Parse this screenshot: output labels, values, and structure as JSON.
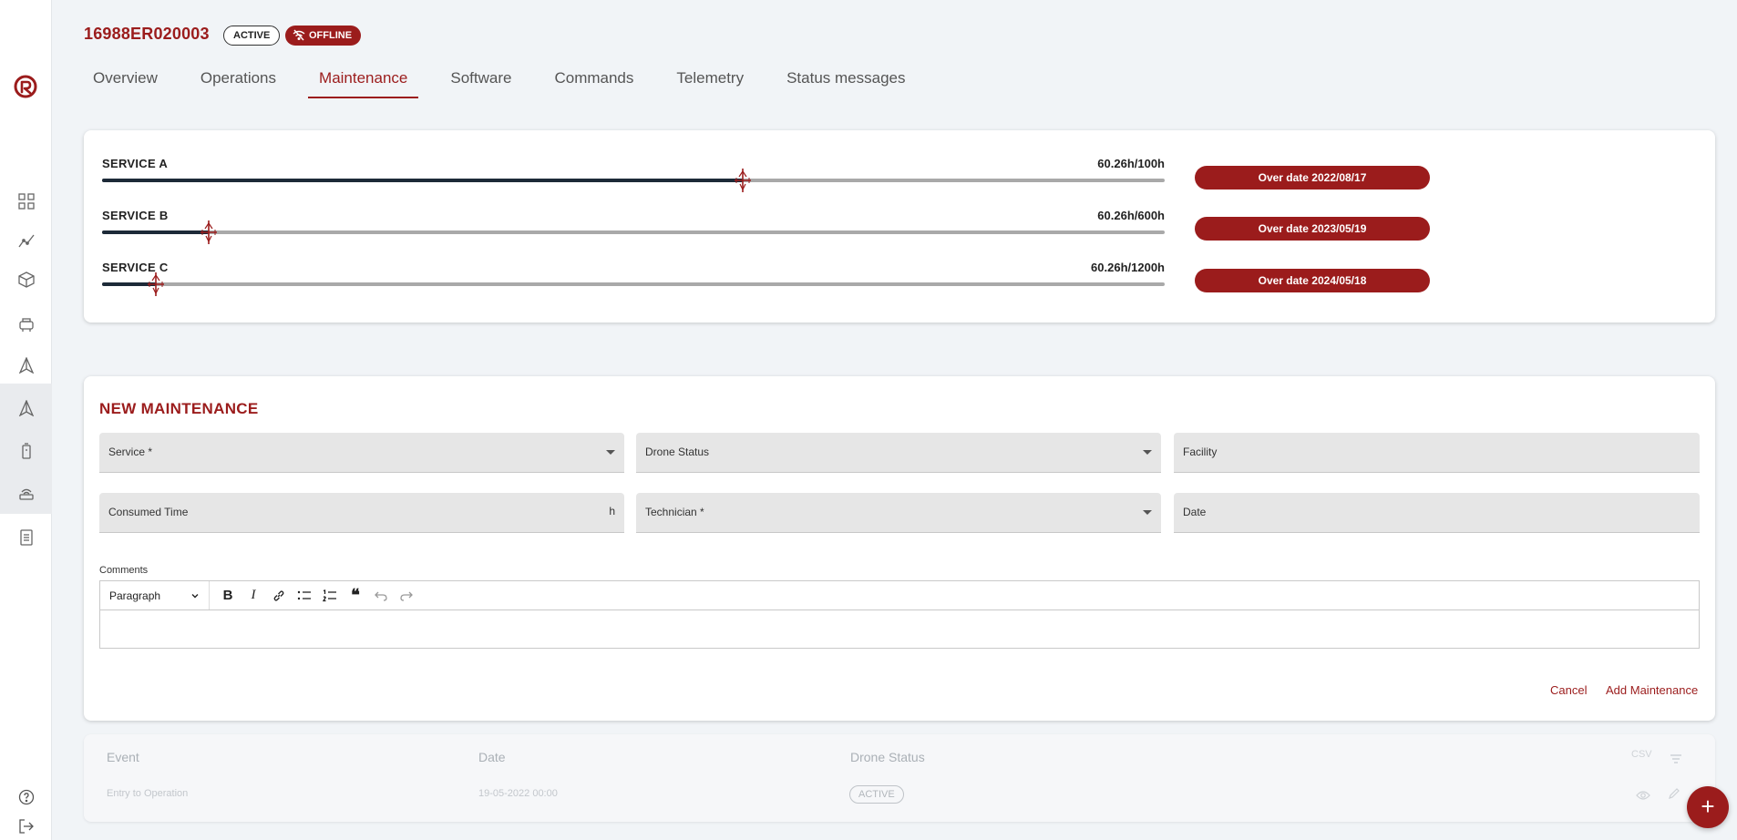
{
  "header": {
    "device_id": "16988ER020003",
    "status_badge": "ACTIVE",
    "connection_badge": "OFFLINE"
  },
  "tabs": [
    {
      "label": "Overview"
    },
    {
      "label": "Operations"
    },
    {
      "label": "Maintenance",
      "active": true
    },
    {
      "label": "Software"
    },
    {
      "label": "Commands"
    },
    {
      "label": "Telemetry"
    },
    {
      "label": "Status messages"
    }
  ],
  "services": [
    {
      "name": "SERVICE A",
      "value_text": "60.26h/100h",
      "progress": 0.6026,
      "over_date": "Over date 2022/08/17"
    },
    {
      "name": "SERVICE B",
      "value_text": "60.26h/600h",
      "progress": 0.1004,
      "over_date": "Over date 2023/05/19"
    },
    {
      "name": "SERVICE C",
      "value_text": "60.26h/1200h",
      "progress": 0.0502,
      "over_date": "Over date 2024/05/18"
    }
  ],
  "new_maintenance": {
    "title": "NEW MAINTENANCE",
    "fields": {
      "service": "Service *",
      "drone_status": "Drone Status",
      "facility": "Facility",
      "consumed_time": "Consumed Time",
      "consumed_time_unit": "h",
      "technician": "Technician *",
      "date": "Date"
    },
    "comments_label": "Comments",
    "editor": {
      "paragraph_select": "Paragraph"
    },
    "cancel_label": "Cancel",
    "add_label": "Add Maintenance"
  },
  "table": {
    "columns": [
      "Event",
      "Date",
      "Drone Status"
    ],
    "csv_label": "CSV",
    "rows": [
      {
        "event": "Entry to Operation",
        "date": "19-05-2022 00:00",
        "drone_status": "ACTIVE"
      }
    ]
  },
  "icons": {
    "sidebar": [
      "logo-icon",
      "dashboard-icon",
      "analytics-icon",
      "package-icon",
      "printer-icon",
      "drone-icon",
      "drone-icon",
      "battery-icon",
      "router-icon",
      "document-icon",
      "help-icon",
      "logout-icon"
    ]
  },
  "colors": {
    "accent": "#9b1c1c",
    "track": "#a9a9a9",
    "fill": "#1d2a38"
  }
}
